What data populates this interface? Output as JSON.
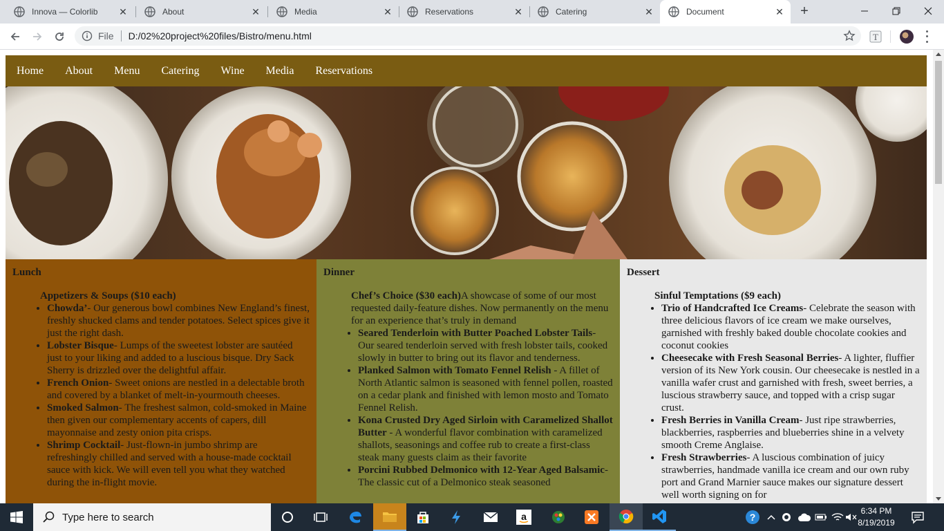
{
  "browser": {
    "tabs": [
      {
        "title": "Innova — Colorlib Web"
      },
      {
        "title": "About"
      },
      {
        "title": "Media"
      },
      {
        "title": "Reservations"
      },
      {
        "title": "Catering"
      },
      {
        "title": "Document"
      }
    ],
    "address": {
      "scheme_label": "File",
      "url": "D:/02%20project%20files/Bistro/menu.html"
    }
  },
  "site": {
    "nav": [
      "Home",
      "About",
      "Menu",
      "Catering",
      "Wine",
      "Media",
      "Reservations"
    ],
    "colors": {
      "nav_bg": "#7a5c12",
      "lunch_bg": "#8f5308",
      "dinner_bg": "#7e8138",
      "dessert_bg": "#e8e8e8"
    },
    "lunch": {
      "heading": "Lunch",
      "section": "Appetizers & Soups ($10 each)",
      "items": [
        {
          "name": "Chowda’",
          "desc": "- Our generous bowl combines New England’s finest, freshly shucked clams and tender potatoes. Select spices give it just the right dash."
        },
        {
          "name": "Lobster Bisque",
          "desc": "- Lumps of the sweetest lobster are sautéed just to your liking and added to a luscious bisque. Dry Sack Sherry is drizzled over the delightful affair."
        },
        {
          "name": "French Onion",
          "desc": "- Sweet onions are nestled in a delectable broth and covered by a blanket of melt-in-yourmouth cheeses."
        },
        {
          "name": "Smoked Salmon",
          "desc": "- The freshest salmon, cold-smoked in Maine then given our complementary accents of capers, dill mayonnaise and zesty onion pita crisps."
        },
        {
          "name": "Shrimp Cocktail",
          "desc": "- Just-flown-in jumbo shrimp are refreshingly chilled and served with a house-made cocktail sauce with kick. We will even tell you what they watched during the in-flight movie."
        }
      ]
    },
    "dinner": {
      "heading": "Dinner",
      "section": "Chef’s Choice ($30 each)",
      "section_desc": "A showcase of some of our most requested daily-feature dishes. Now permanently on the menu for an experience that’s truly in demand",
      "items": [
        {
          "name": "Seared Tenderloin with Butter Poached Lobster Tails",
          "desc": "- Our seared tenderloin served with fresh lobster tails, cooked slowly in butter to bring out its flavor and tenderness."
        },
        {
          "name": "Planked Salmon with Tomato Fennel Relish",
          "desc": " - A fillet of North Atlantic salmon is seasoned with fennel pollen, roasted on a cedar plank and finished with lemon mosto and Tomato Fennel Relish."
        },
        {
          "name": "Kona Crusted Dry Aged Sirloin with Caramelized Shallot Butter",
          "desc": " - A wonderful flavor combination with caramelized shallots, seasonings and coffee rub to create a first-class steak many guests claim as their favorite"
        },
        {
          "name": "Porcini Rubbed Delmonico with 12-Year Aged Balsamic",
          "desc": "- The classic cut of a Delmonico steak seasoned"
        }
      ]
    },
    "dessert": {
      "heading": "Dessert",
      "section": "Sinful Temptations ($9 each)",
      "items": [
        {
          "name": "Trio of Handcrafted Ice Creams",
          "desc": "- Celebrate the season with three delicious flavors of ice cream we make ourselves, garnished with freshly baked double chocolate cookies and coconut cookies"
        },
        {
          "name": "Cheesecake with Fresh Seasonal Berries",
          "desc": "- A lighter, fluffier version of its New York cousin. Our cheesecake is nestled in a vanilla wafer crust and garnished with fresh, sweet berries, a luscious strawberry sauce, and topped with a crisp sugar crust."
        },
        {
          "name": "Fresh Berries in Vanilla Cream",
          "desc": "- Just ripe strawberries, blackberries, raspberries and blueberries shine in a velvety smooth Creme Anglaise."
        },
        {
          "name": "Fresh Strawberries",
          "desc": "- A luscious combination of juicy strawberries, handmade vanilla ice cream and our own ruby port and Grand Marnier sauce makes our signature dessert well worth signing on for"
        }
      ]
    }
  },
  "taskbar": {
    "search_placeholder": "Type here to search",
    "time": "6:34 PM",
    "date": "8/19/2019"
  }
}
